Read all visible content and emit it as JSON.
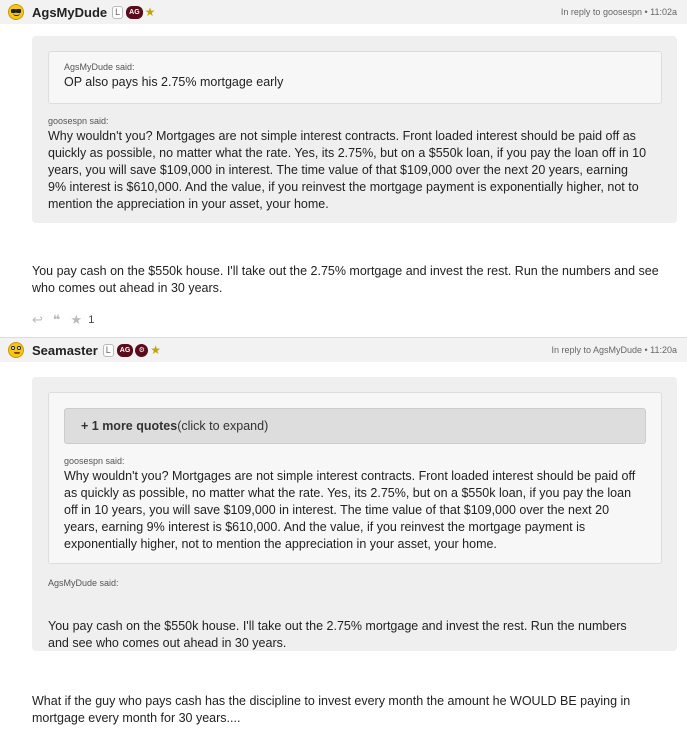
{
  "post1": {
    "username": "AgsMyDude",
    "badge_l": "L",
    "badge_ag": "AG",
    "reply_meta": "In reply to goosespn • 11:02a",
    "nested_quote_author": "AgsMyDude said:",
    "nested_quote_text": "OP also pays his 2.75% mortgage early",
    "quote_author": "goosespn said:",
    "quote_text": "Why wouldn't you? Mortgages are not simple interest contracts. Front loaded interest should be paid off as quickly as possible, no matter what the rate. Yes, its 2.75%, but on a $550k loan, if you pay the loan off in 10 years, you will save $109,000 in interest. The time value of that $109,000 over the next 20 years, earning 9% interest is $610,000. And the value, if you reinvest the mortgage payment is exponentially higher, not to mention the appreciation in your asset, your home.",
    "text": "You pay cash on the $550k house. I'll take out the 2.75% mortgage and invest the rest. Run the numbers and see who comes out ahead in 30 years.",
    "like_count": "1"
  },
  "post2": {
    "username": "Seamaster",
    "badge_l": "L",
    "badge_ag": "AG",
    "badge_tx": "⚙",
    "reply_meta": "In reply to AgsMyDude • 11:20a",
    "expand_bold": "+ 1 more quotes",
    "expand_rest": " (click to expand)",
    "inner_quote_author": "goosespn said:",
    "inner_quote_text": "Why wouldn't you? Mortgages are not simple interest contracts. Front loaded interest should be paid off as quickly as possible, no matter what the rate. Yes, its 2.75%, but on a $550k loan, if you pay the loan off in 10 years, you will save $109,000 in interest. The time value of that $109,000 over the next 20 years, earning 9% interest is $610,000. And the value, if you reinvest the mortgage payment is exponentially higher, not to mention the appreciation in your asset, your home.",
    "quote_author": "AgsMyDude said:",
    "quote_text": "You pay cash on the $550k house. I'll take out the 2.75% mortgage and invest the rest. Run the numbers and see who comes out ahead in 30 years.",
    "text": "What if the guy who pays cash has the discipline to invest every month the amount he WOULD BE paying in mortgage every month for 30 years...."
  },
  "colors": {
    "header_bg": "#f2f2f2",
    "quote_bg": "#efefef",
    "ag_badge": "#5b0b1a",
    "star": "#c8a000"
  },
  "icons": [
    "sunglasses-avatar-icon",
    "nerd-avatar-icon",
    "reply-icon",
    "quote-icon",
    "star-icon"
  ]
}
